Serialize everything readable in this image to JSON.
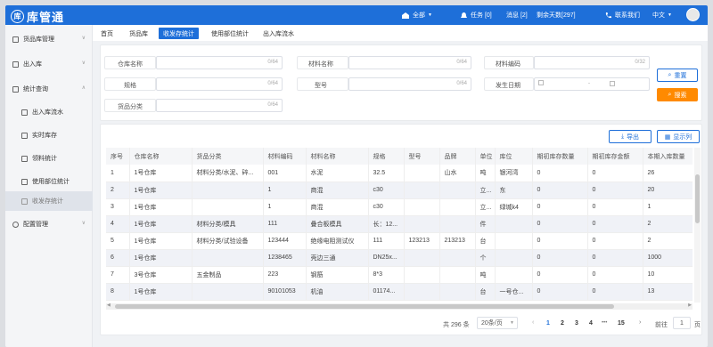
{
  "app": {
    "logo_glyph": "库",
    "title": "库管通"
  },
  "topbar": {
    "scope": "全部",
    "task": "任务 [0]",
    "message": "消息 [2]",
    "remaining": "剩余天数[297]",
    "contact": "联系我们",
    "language": "中文"
  },
  "sidebar": {
    "items": [
      {
        "label": "货品库管理",
        "icon": "box-icon"
      },
      {
        "label": "出入库",
        "icon": "transfer-icon"
      },
      {
        "label": "统计查询",
        "icon": "chart-icon"
      },
      {
        "label": "出入库流水",
        "icon": "list-icon"
      },
      {
        "label": "实时库存",
        "icon": "stock-icon"
      },
      {
        "label": "领料统计",
        "icon": "receipt-icon"
      },
      {
        "label": "使用部位统计",
        "icon": "location-icon"
      },
      {
        "label": "收发存统计",
        "icon": "summary-icon"
      },
      {
        "label": "配置管理",
        "icon": "gear-icon"
      }
    ]
  },
  "tabs": [
    "首页",
    "货品库",
    "收发存统计",
    "使用部位统计",
    "出入库流水"
  ],
  "filters": {
    "warehouse_label": "仓库名称",
    "warehouse_count": "0/64",
    "material_name_label": "材料名称",
    "material_name_count": "0/64",
    "material_code_label": "材料编码",
    "material_code_count": "0/32",
    "spec_label": "规格",
    "spec_count": "0/64",
    "model_label": "型号",
    "model_count": "0/64",
    "date_label": "发生日期",
    "date_sep": "-",
    "category_label": "货品分类",
    "category_count": "0/64",
    "reset": "重置",
    "search": "搜索"
  },
  "actions": {
    "export": "导出",
    "columns": "显示列"
  },
  "table": {
    "headers": [
      "序号",
      "仓库名称",
      "货品分类",
      "材料编码",
      "材料名称",
      "规格",
      "型号",
      "品牌",
      "单位",
      "库位",
      "期初库存数量",
      "期初库存金额",
      "本期入库数量"
    ],
    "rows": [
      [
        "1",
        "1号仓库",
        "材料分类/水泥、碎...",
        "001",
        "水泥",
        "32.5",
        "",
        "山水",
        "吨",
        "银河湾",
        "0",
        "0",
        "26"
      ],
      [
        "2",
        "1号仓库",
        "",
        "1",
        "商混",
        "c30",
        "",
        "",
        "立...",
        "东",
        "0",
        "0",
        "20"
      ],
      [
        "3",
        "1号仓库",
        "",
        "1",
        "商混",
        "c30",
        "",
        "",
        "立...",
        "绿城k4",
        "0",
        "0",
        "1"
      ],
      [
        "4",
        "1号仓库",
        "材料分类/模具",
        "111",
        "叠合板模具",
        "长：12...",
        "",
        "",
        "件",
        "",
        "0",
        "0",
        "2"
      ],
      [
        "5",
        "1号仓库",
        "材料分类/试验设备",
        "123444",
        "绝缘电阻测试仪",
        "111",
        "123213",
        "213213",
        "台",
        "",
        "0",
        "0",
        "2"
      ],
      [
        "6",
        "1号仓库",
        "",
        "1238465",
        "壳边三通",
        "DN25x...",
        "",
        "",
        "个",
        "",
        "0",
        "0",
        "1000"
      ],
      [
        "7",
        "3号仓库",
        "五金制品",
        "223",
        "钢筋",
        "8*3",
        "",
        "",
        "吨",
        "",
        "0",
        "0",
        "10"
      ],
      [
        "8",
        "1号仓库",
        "",
        "90101053",
        "机油",
        "01174...",
        "",
        "",
        "台",
        "一号仓...",
        "0",
        "0",
        "13"
      ]
    ]
  },
  "pagination": {
    "total": "共 296 条",
    "page_size": "20条/页",
    "prev": "‹",
    "pages": [
      "1",
      "2",
      "3",
      "4"
    ],
    "ellipsis": "•••",
    "last": "15",
    "next": "›",
    "goto_label": "前往",
    "goto_value": "1",
    "goto_unit": "页"
  },
  "colors": {
    "primary": "#1e6fd9",
    "accent": "#ff8a00"
  }
}
